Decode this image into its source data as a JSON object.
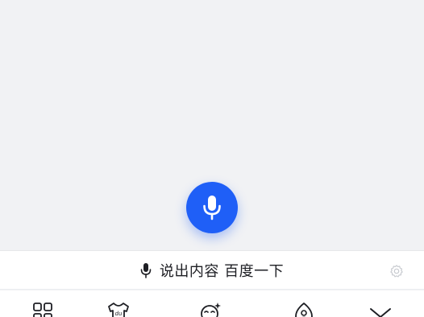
{
  "voice": {
    "hint": "说出内容 百度一下",
    "mic_icon": "microphone-icon",
    "settings_icon": "gear-icon"
  },
  "toolbar": {
    "items": [
      {
        "icon": "grid-icon"
      },
      {
        "icon": "tshirt-du-icon"
      },
      {
        "icon": "sparkle-face-icon"
      },
      {
        "icon": "drop-person-icon"
      },
      {
        "icon": "collapse-chevron-icon"
      }
    ]
  },
  "colors": {
    "accent": "#1f5ff7",
    "background": "#f1f2f4",
    "text": "#1e1f24",
    "icon_gray": "#c8cbd0"
  }
}
